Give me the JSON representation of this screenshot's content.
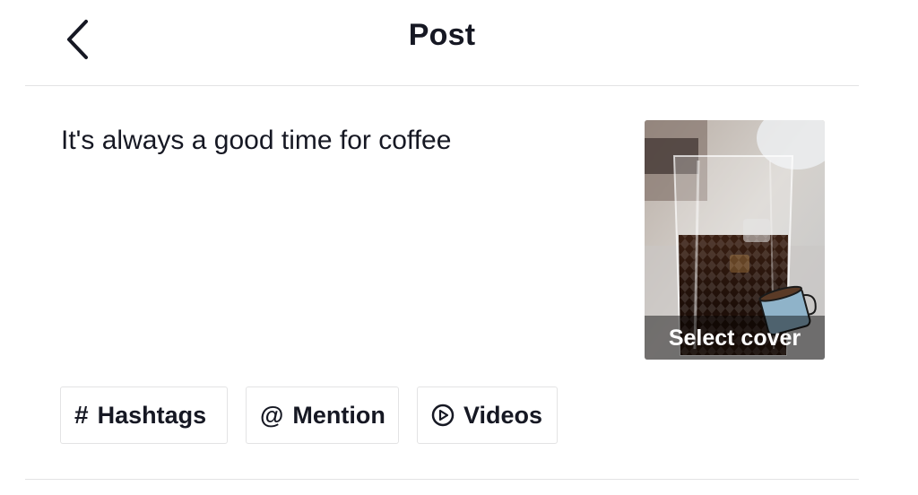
{
  "header": {
    "title": "Post",
    "back_icon": "chevron-left-icon"
  },
  "caption": {
    "value": "It's always a good time for coffee"
  },
  "cover": {
    "label": "Select cover",
    "image": "iced-coffee-glass-thumbnail"
  },
  "chips": [
    {
      "icon": "hashtag-icon",
      "glyph": "#",
      "label": "Hashtags"
    },
    {
      "icon": "at-sign-icon",
      "glyph": "@",
      "label": "Mention"
    },
    {
      "icon": "play-circle-icon",
      "glyph": "",
      "label": "Videos"
    }
  ],
  "colors": {
    "text": "#161823",
    "divider": "#e3e3e4",
    "background": "#ffffff"
  }
}
